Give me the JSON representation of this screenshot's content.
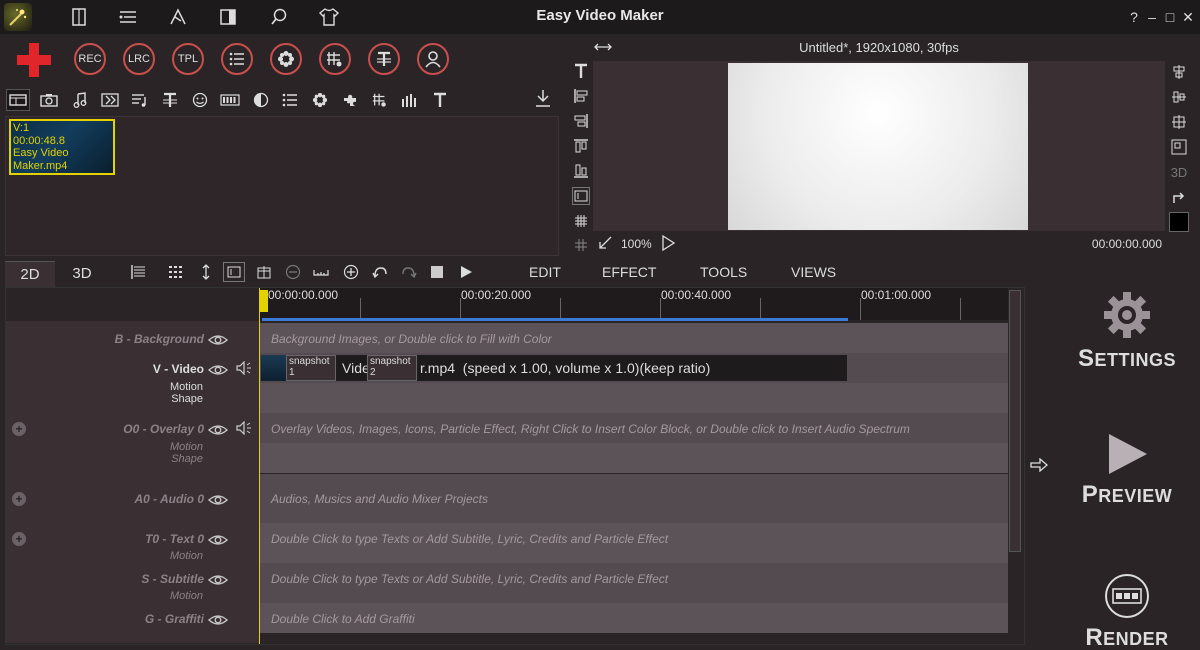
{
  "app": {
    "title": "Easy Video Maker"
  },
  "window_controls": {
    "help": "?",
    "minimize": "–",
    "maximize": "□",
    "close": "✕"
  },
  "main_toolbar": {
    "buttons": [
      {
        "label": "REC"
      },
      {
        "label": "LRC"
      },
      {
        "label": "TPL"
      }
    ]
  },
  "media_library": {
    "clip": {
      "line1": "V:1",
      "line2": "00:00:48.8",
      "line3": "Easy Video",
      "line4": "Maker.mp4"
    }
  },
  "preview": {
    "title": "Untitled*, 1920x1080, 30fps",
    "zoom": "100%",
    "time": "00:00:00.000"
  },
  "side_tools": {
    "label_3d": "3D"
  },
  "edit_toolbar": {
    "tabs": [
      {
        "label": "2D"
      },
      {
        "label": "3D"
      }
    ],
    "menu": [
      {
        "label": "EDIT"
      },
      {
        "label": "EFFECT"
      },
      {
        "label": "TOOLS"
      },
      {
        "label": "VIEWS"
      }
    ]
  },
  "timeline": {
    "ruler": [
      {
        "label": "00:00:00.000"
      },
      {
        "label": "00:00:20.000"
      },
      {
        "label": "00:00:40.000"
      },
      {
        "label": "00:01:00.000"
      }
    ],
    "tracks": {
      "background": {
        "label": "B - Background",
        "hint": "Background Images, or Double click to Fill with Color"
      },
      "video": {
        "label": "V - Video",
        "sub1": "Motion",
        "sub2": "Shape",
        "clip_prefix": "Vide",
        "clip_suffix": "r.mp4  (speed x 1.00, volume x 1.0)(keep ratio)",
        "snapshot1": "snapshot",
        "snapshot1_n": "1",
        "snapshot2": "snapshot",
        "snapshot2_n": "2"
      },
      "overlay": {
        "label": "O0 - Overlay 0",
        "sub1": "Motion",
        "sub2": "Shape",
        "hint": "Overlay Videos, Images, Icons, Particle Effect, Right Click to Insert Color Block, or Double click to Insert Audio Spectrum"
      },
      "audio": {
        "label": "A0 - Audio 0",
        "hint": "Audios, Musics and Audio Mixer Projects"
      },
      "text": {
        "label": "T0 - Text 0",
        "sub1": "Motion",
        "hint": "Double Click to type Texts or Add Subtitle, Lyric, Credits and Particle Effect"
      },
      "subtitle": {
        "label": "S - Subtitle",
        "sub1": "Motion",
        "hint": "Double Click to type Texts or Add Subtitle, Lyric, Credits and Particle Effect"
      },
      "graffiti": {
        "label": "G - Graffiti",
        "hint": "Double Click to Add Graffiti"
      }
    }
  },
  "actions": {
    "settings": {
      "cap": "S",
      "rest": "ETTINGS"
    },
    "preview": {
      "cap": "P",
      "rest": "REVIEW"
    },
    "render": {
      "cap": "R",
      "rest": "ENDER"
    }
  },
  "colors": {
    "accent_red": "#e0262a",
    "playhead": "#e3d100",
    "progress": "#3a7bd5"
  }
}
